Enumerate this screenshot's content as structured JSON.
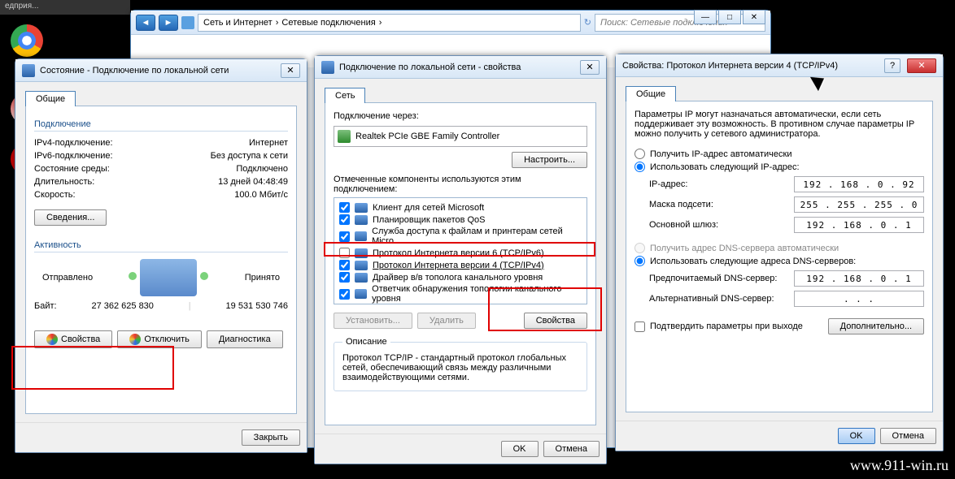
{
  "desktop": {
    "tab_label": "едприя..."
  },
  "explorer": {
    "breadcrumb": [
      "Сеть и Интернет",
      "Сетевые подключения"
    ],
    "search_placeholder": "Поиск: Сетевые подключения"
  },
  "status_dlg": {
    "title": "Состояние - Подключение по локальной сети",
    "tab_general": "Общие",
    "group_conn": "Подключение",
    "rows": [
      {
        "k": "IPv4-подключение:",
        "v": "Интернет"
      },
      {
        "k": "IPv6-подключение:",
        "v": "Без доступа к сети"
      },
      {
        "k": "Состояние среды:",
        "v": "Подключено"
      },
      {
        "k": "Длительность:",
        "v": "13 дней 04:48:49"
      },
      {
        "k": "Скорость:",
        "v": "100.0 Мбит/с"
      }
    ],
    "btn_details": "Сведения...",
    "group_activity": "Активность",
    "sent_lbl": "Отправлено",
    "recv_lbl": "Принято",
    "bytes_lbl": "Байт:",
    "sent": "27 362 625 830",
    "recv": "19 531 530 746",
    "btn_props": "Свойства",
    "btn_disable": "Отключить",
    "btn_diag": "Диагностика",
    "btn_close": "Закрыть"
  },
  "props_dlg": {
    "title": "Подключение по локальной сети - свойства",
    "tab_net": "Сеть",
    "connect_via": "Подключение через:",
    "nic": "Realtek PCIe GBE Family Controller",
    "btn_configure": "Настроить...",
    "components_lbl": "Отмеченные компоненты используются этим подключением:",
    "items": [
      {
        "c": true,
        "t": "Клиент для сетей Microsoft"
      },
      {
        "c": true,
        "t": "Планировщик пакетов QoS"
      },
      {
        "c": true,
        "t": "Служба доступа к файлам и принтерам сетей Micro..."
      },
      {
        "c": false,
        "t": "Протокол Интернета версии 6 (TCP/IPv6)"
      },
      {
        "c": true,
        "t": "Протокол Интернета версии 4 (TCP/IPv4)",
        "hl": true
      },
      {
        "c": true,
        "t": "Драйвер в/в тополога канального уровня"
      },
      {
        "c": true,
        "t": "Ответчик обнаружения топологии канального уровня"
      }
    ],
    "btn_install": "Установить...",
    "btn_remove": "Удалить",
    "btn_item_props": "Свойства",
    "desc_lbl": "Описание",
    "desc": "Протокол TCP/IP - стандартный протокол глобальных сетей, обеспечивающий связь между различными взаимодействующими сетями.",
    "ok": "OK",
    "cancel": "Отмена"
  },
  "ipv4_dlg": {
    "title": "Свойства: Протокол Интернета версии 4 (TCP/IPv4)",
    "tab_general": "Общие",
    "intro": "Параметры IP могут назначаться автоматически, если сеть поддерживает эту возможность. В противном случае параметры IP можно получить у сетевого администратора.",
    "r_auto_ip": "Получить IP-адрес автоматически",
    "r_manual_ip": "Использовать следующий IP-адрес:",
    "ip_lbl": "IP-адрес:",
    "ip": "192 . 168 .  0  .  92",
    "mask_lbl": "Маска подсети:",
    "mask": "255 . 255 . 255 .  0",
    "gw_lbl": "Основной шлюз:",
    "gw": "192 . 168 .  0  .  1",
    "r_auto_dns": "Получить адрес DNS-сервера автоматически",
    "r_manual_dns": "Использовать следующие адреса DNS-серверов:",
    "dns1_lbl": "Предпочитаемый DNS-сервер:",
    "dns1": "192 . 168 .  0  .  1",
    "dns2_lbl": "Альтернативный DNS-сервер:",
    "dns2": " .       .       . ",
    "confirm_exit": "Подтвердить параметры при выходе",
    "btn_adv": "Дополнительно...",
    "ok": "OK",
    "cancel": "Отмена"
  },
  "watermark": "www.911-win.ru"
}
